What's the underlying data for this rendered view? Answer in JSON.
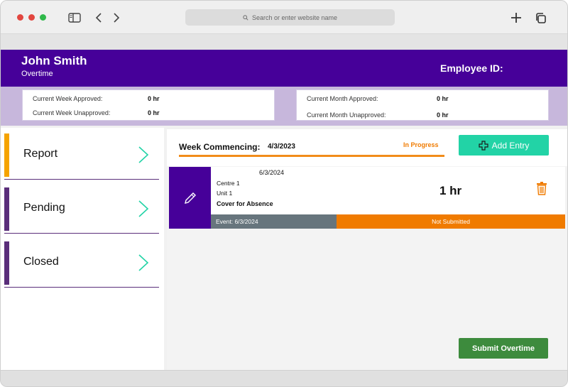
{
  "browser": {
    "address_placeholder": "Search or enter website name"
  },
  "header": {
    "name": "John Smith",
    "subtitle": "Overtime",
    "employee_id_label": "Employee ID:"
  },
  "stats": {
    "week_approved_label": "Current Week Approved:",
    "week_approved_value": "0 hr",
    "week_unapproved_label": "Current Week Unapproved:",
    "week_unapproved_value": "0 hr",
    "month_approved_label": "Current Month Approved:",
    "month_approved_value": "0 hr",
    "month_unapproved_label": "Current Month Unapproved:",
    "month_unapproved_value": "0 hr"
  },
  "sidebar": {
    "items": [
      {
        "label": "Report",
        "accent": "#f5a300"
      },
      {
        "label": "Pending",
        "accent": "#5a2e7a"
      },
      {
        "label": "Closed",
        "accent": "#5a2e7a"
      }
    ]
  },
  "week": {
    "label": "Week Commencing:",
    "date": "4/3/2023",
    "status": "In Progress",
    "add_entry_label": "Add Entry"
  },
  "entry": {
    "date": "6/3/2024",
    "centre": "Centre 1",
    "unit": "Unit 1",
    "reason": "Cover for Absence",
    "hours": "1 hr",
    "event": "Event: 6/3/2024",
    "status": "Not Submitted"
  },
  "actions": {
    "submit_label": "Submit Overtime"
  },
  "colors": {
    "brand_purple": "#460099",
    "accent_orange": "#f07b00",
    "add_teal": "#22d3a6",
    "submit_green": "#3d8b3d"
  }
}
